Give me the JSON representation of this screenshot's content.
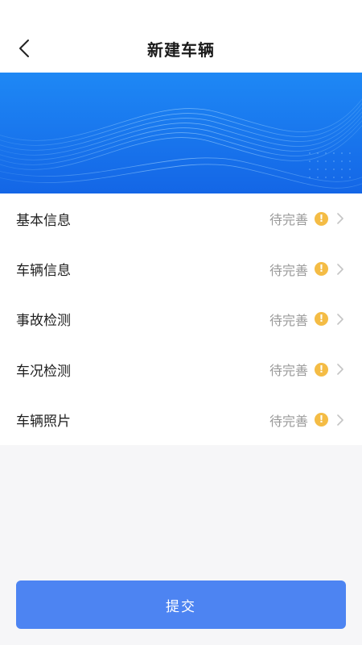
{
  "header": {
    "title": "新建车辆",
    "back_icon": "chevron-left-icon"
  },
  "banner": {
    "color_top": "#1e88f5",
    "color_bottom": "#1466e6"
  },
  "items": [
    {
      "label": "基本信息",
      "status": "待完善",
      "status_icon": "exclamation-icon"
    },
    {
      "label": "车辆信息",
      "status": "待完善",
      "status_icon": "exclamation-icon"
    },
    {
      "label": "事故检测",
      "status": "待完善",
      "status_icon": "exclamation-icon"
    },
    {
      "label": "车况检测",
      "status": "待完善",
      "status_icon": "exclamation-icon"
    },
    {
      "label": "车辆照片",
      "status": "待完善",
      "status_icon": "exclamation-icon"
    }
  ],
  "warning_color": "#f4bc45",
  "submit": {
    "label": "提交",
    "color": "#4d84f2"
  }
}
